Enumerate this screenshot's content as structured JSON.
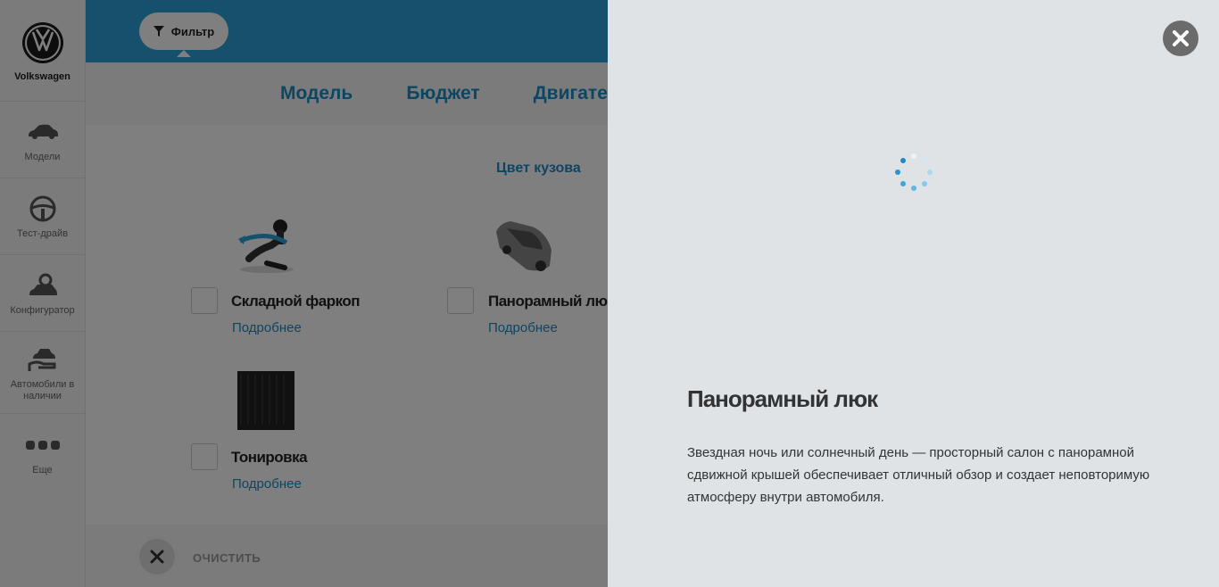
{
  "brand": {
    "name": "Volkswagen",
    "logo_icon": "vw-logo-icon"
  },
  "sidebar": {
    "items": [
      {
        "label": "Модели",
        "icon": "car-icon"
      },
      {
        "label": "Тест-драйв",
        "icon": "steering-wheel-icon"
      },
      {
        "label": "Конфигуратор",
        "icon": "car-gear-icon"
      },
      {
        "label": "Автомобили в наличии",
        "icon": "car-hand-icon"
      },
      {
        "label": "Еще",
        "icon": "more-dots-icon"
      }
    ]
  },
  "topbar": {
    "filter_label": "Фильтр",
    "accent": "#2aa3d8"
  },
  "filter_tabs": [
    "Модель",
    "Бюджет",
    "Двигате"
  ],
  "section": {
    "title": "Цвет кузова"
  },
  "options": [
    {
      "name": "Складной фаркоп",
      "more": "Подробнее",
      "image_icon": "towbar-icon"
    },
    {
      "name": "Панорамный люк",
      "more": "Подробнее",
      "image_icon": "car-sunroof-icon"
    },
    {
      "name": "Тонировка",
      "more": "Подробнее",
      "image_icon": "tinted-glass-icon"
    }
  ],
  "footer": {
    "clear_label": "ОЧИСТИТЬ"
  },
  "panel": {
    "title": "Панорамный люк",
    "description": "Звездная ночь или солнечный день — просторный салон с панорамной сдвижной крышей обеспечивает отличный обзор и создает неповторимую атмосферу внутри автомобиля.",
    "close_icon": "close-icon",
    "spinner_icon": "loading-spinner-icon"
  }
}
